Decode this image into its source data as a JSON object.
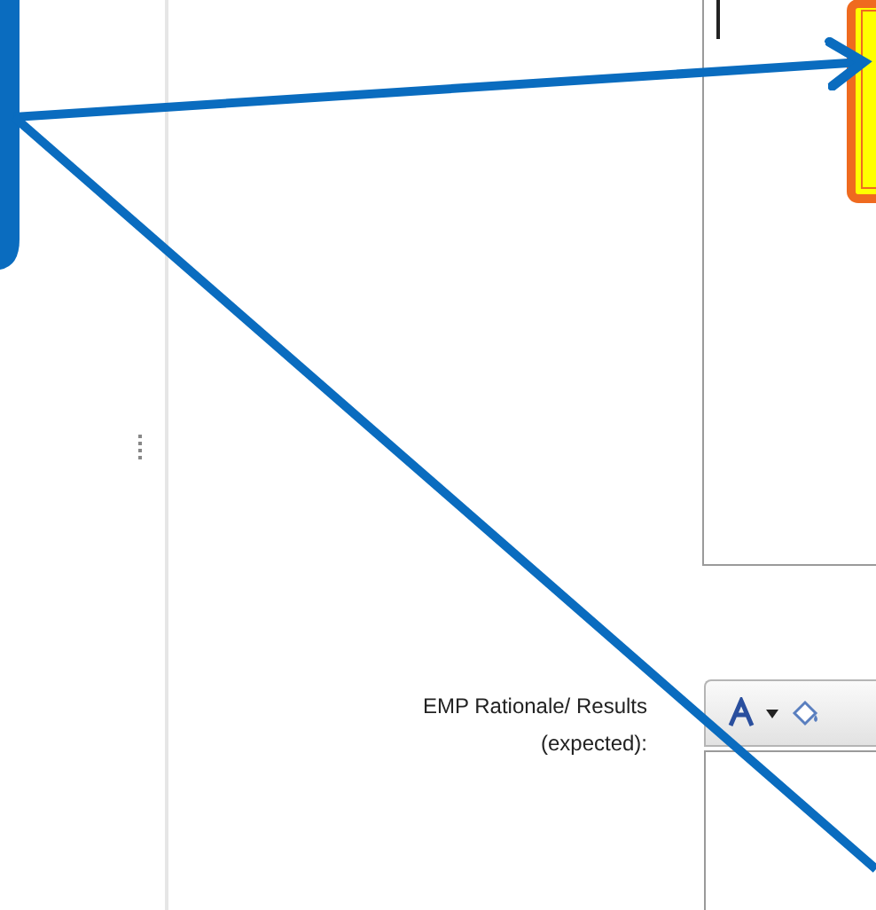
{
  "form": {
    "rationale_field": {
      "label": "EMP Rationale/ Results (expected):"
    }
  }
}
